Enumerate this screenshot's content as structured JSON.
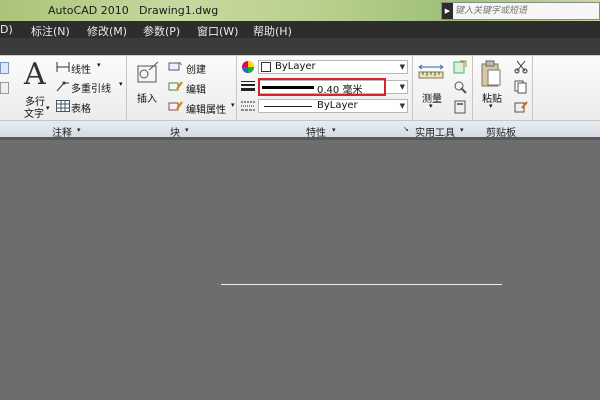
{
  "titlebar": {
    "app": "AutoCAD 2010",
    "doc": "Drawing1.dwg",
    "search_placeholder": "键入关键字或短语"
  },
  "menu": {
    "items": [
      "D)",
      "标注(N)",
      "修改(M)",
      "参数(P)",
      "窗口(W)",
      "帮助(H)"
    ]
  },
  "ribbon": {
    "annotation": {
      "big_letter": "A",
      "text_label_1": "多行",
      "text_label_2": "文字",
      "linear": "线性",
      "multileader": "多重引线",
      "table": "表格",
      "title": "注释"
    },
    "block": {
      "insert": "插入",
      "create": "创建",
      "edit": "编辑",
      "edit_attr": "编辑属性",
      "title": "块"
    },
    "properties": {
      "color_value": "ByLayer",
      "lineweight_value": "0.40 毫米",
      "linetype_value": "ByLayer",
      "title": "特性"
    },
    "utilities": {
      "measure": "测量",
      "title": "实用工具"
    },
    "clipboard": {
      "paste": "粘贴",
      "title": "剪贴板"
    }
  },
  "colors": {
    "highlight_border": "#d8232a",
    "canvas": "#6d6d6d"
  }
}
